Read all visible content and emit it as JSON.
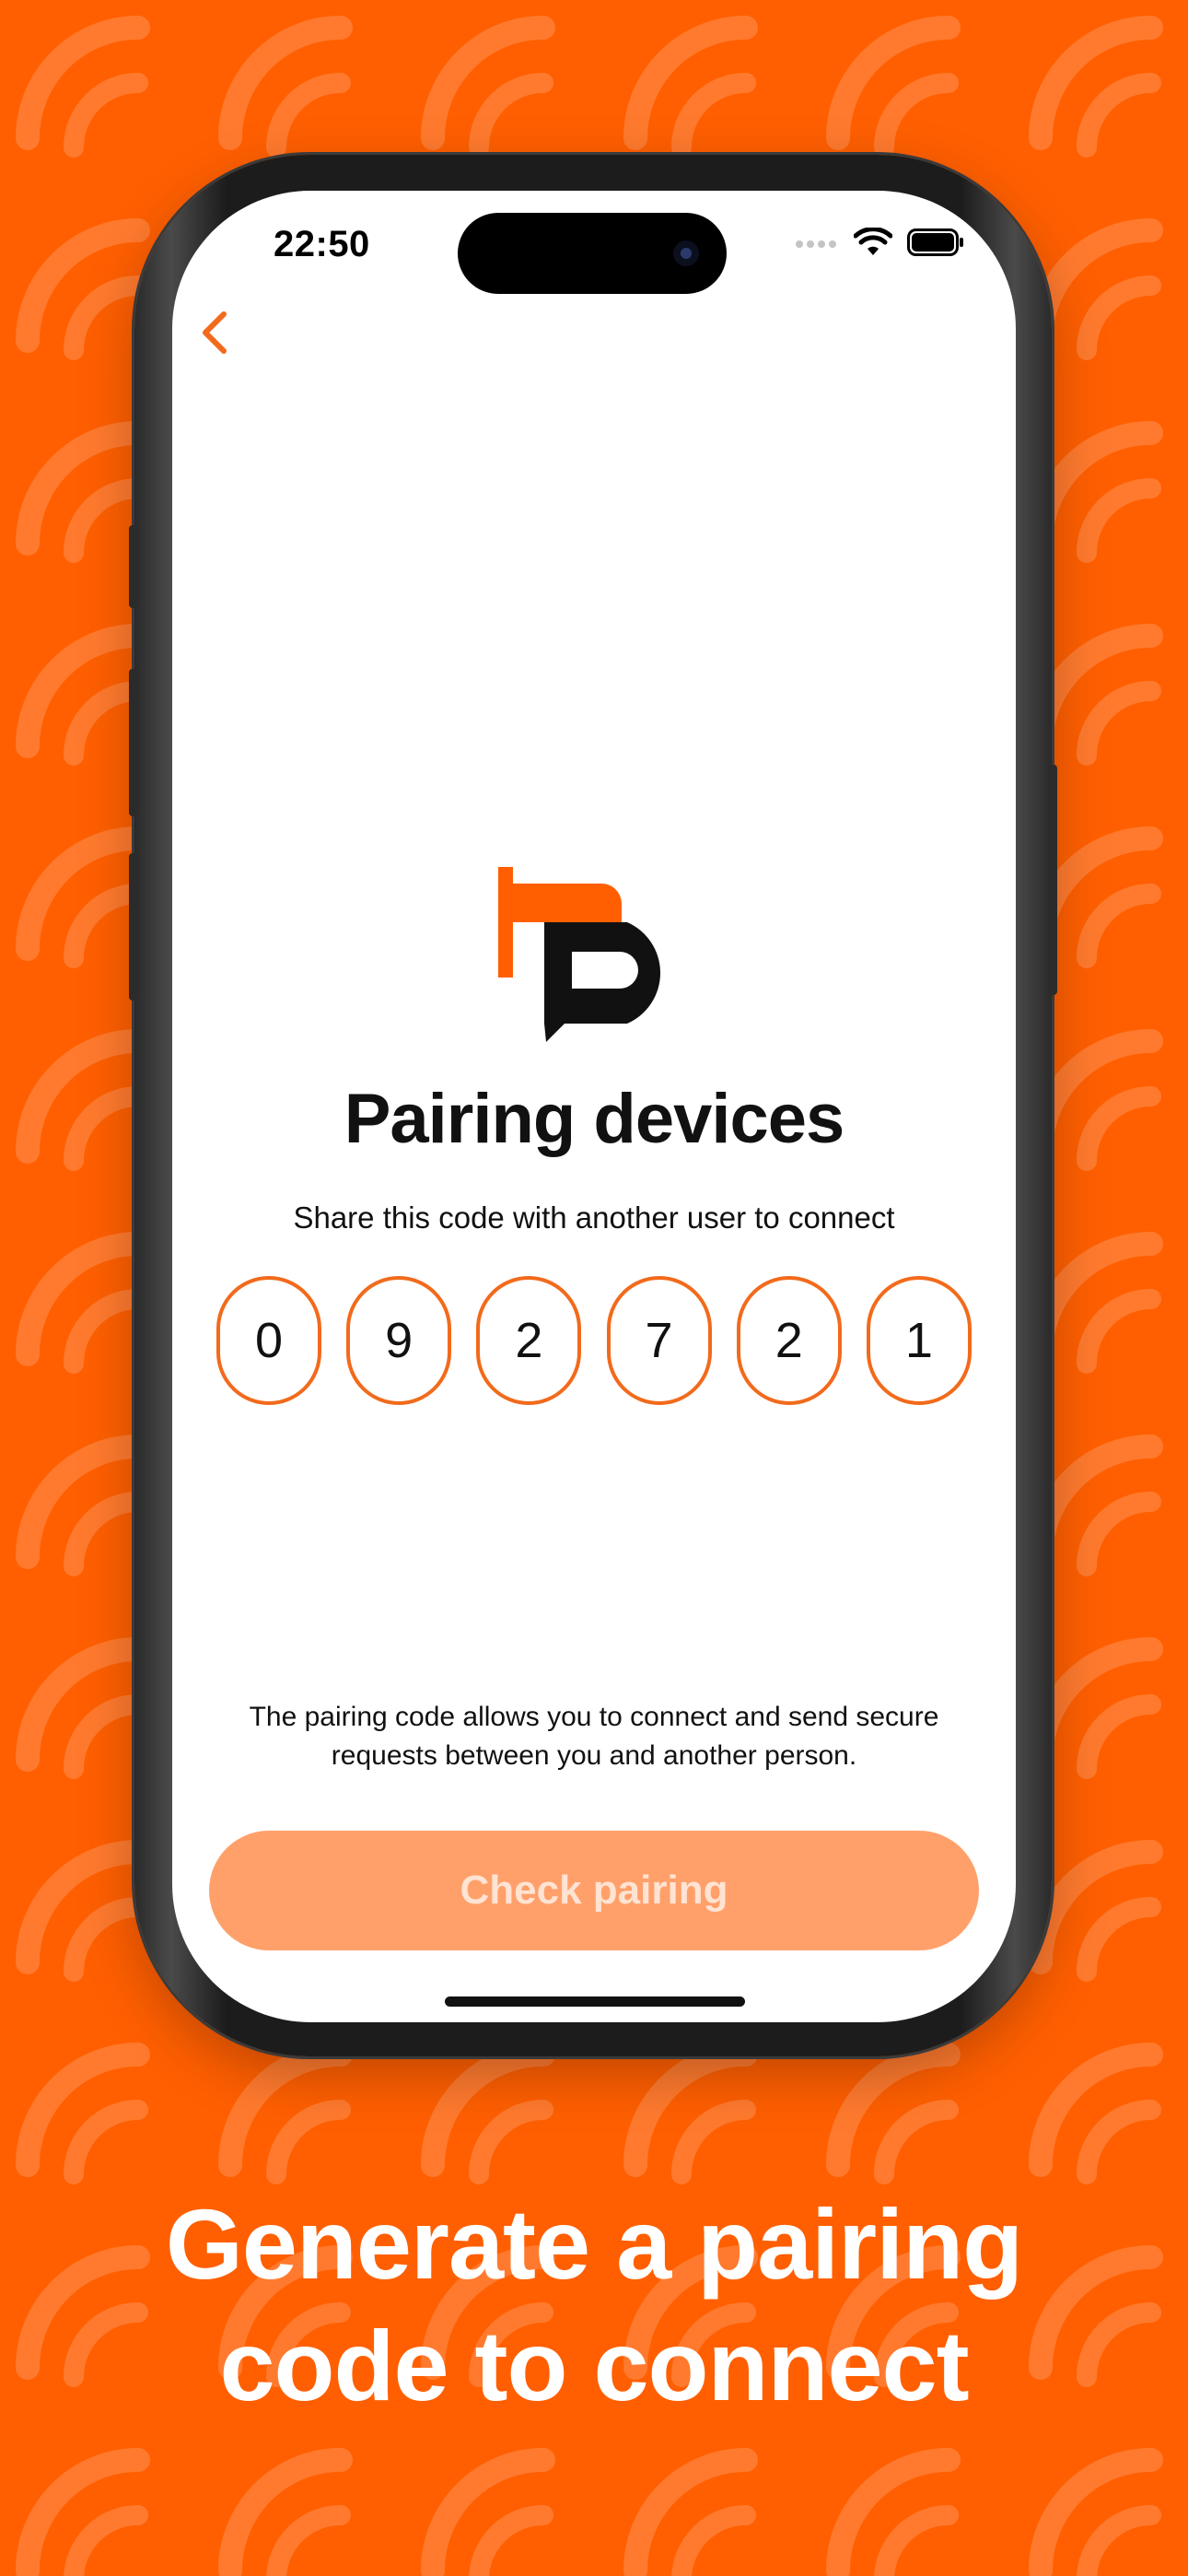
{
  "colors": {
    "brand": "#FF5F00",
    "accent": "#F26A1B",
    "cta_disabled": "#FFA06B"
  },
  "status_bar": {
    "time": "22:50"
  },
  "icons": {
    "back": "chevron-left-icon",
    "logo": "app-logo",
    "wifi": "wifi-icon",
    "battery": "battery-icon",
    "signal": "signal-icon"
  },
  "pairing": {
    "title": "Pairing devices",
    "subtitle": "Share this code with another user to connect",
    "code": [
      "0",
      "9",
      "2",
      "7",
      "2",
      "1"
    ],
    "info_line1": "The pairing code allows you to connect and send secure",
    "info_line2": "requests between you and another person.",
    "cta_label": "Check pairing"
  },
  "marketing": {
    "line1": "Generate a pairing",
    "line2": "code to connect"
  }
}
